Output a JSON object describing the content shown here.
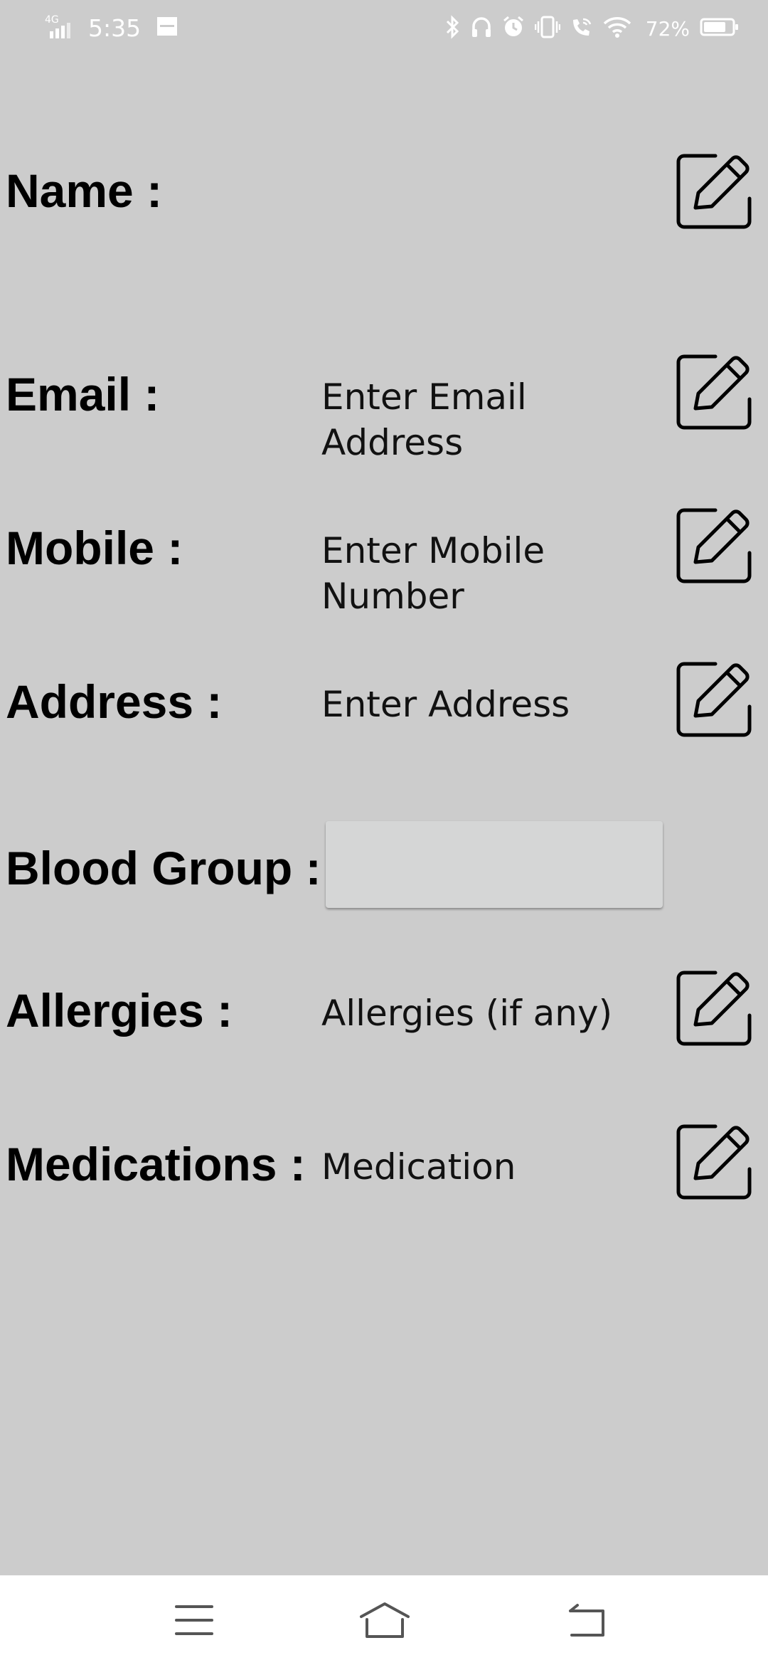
{
  "status_bar": {
    "network": "4G",
    "time": "5:35",
    "battery_percent": "72%",
    "icons": [
      "signal-icon",
      "notification-icon",
      "bluetooth-icon",
      "headphones-icon",
      "alarm-icon",
      "vibrate-icon",
      "wifi-calling-icon",
      "wifi-icon",
      "battery-icon"
    ]
  },
  "form": {
    "name": {
      "label": "Name :",
      "value": ""
    },
    "email": {
      "label": "Email :",
      "value": "Enter Email Address"
    },
    "mobile": {
      "label": "Mobile :",
      "value": "Enter Mobile Number"
    },
    "address": {
      "label": "Address :",
      "value": "Enter Address"
    },
    "blood_group": {
      "label": "Blood Group :",
      "value": ""
    },
    "allergies": {
      "label": "Allergies :",
      "value": "Allergies (if any)"
    },
    "medications": {
      "label": "Medications :",
      "value": "Medication"
    }
  },
  "nav": {
    "icons": [
      "menu-icon",
      "home-icon",
      "back-icon"
    ]
  },
  "colors": {
    "background": "#cccccc",
    "input_box": "#d5d6d6",
    "nav_bar": "#ffffff"
  }
}
